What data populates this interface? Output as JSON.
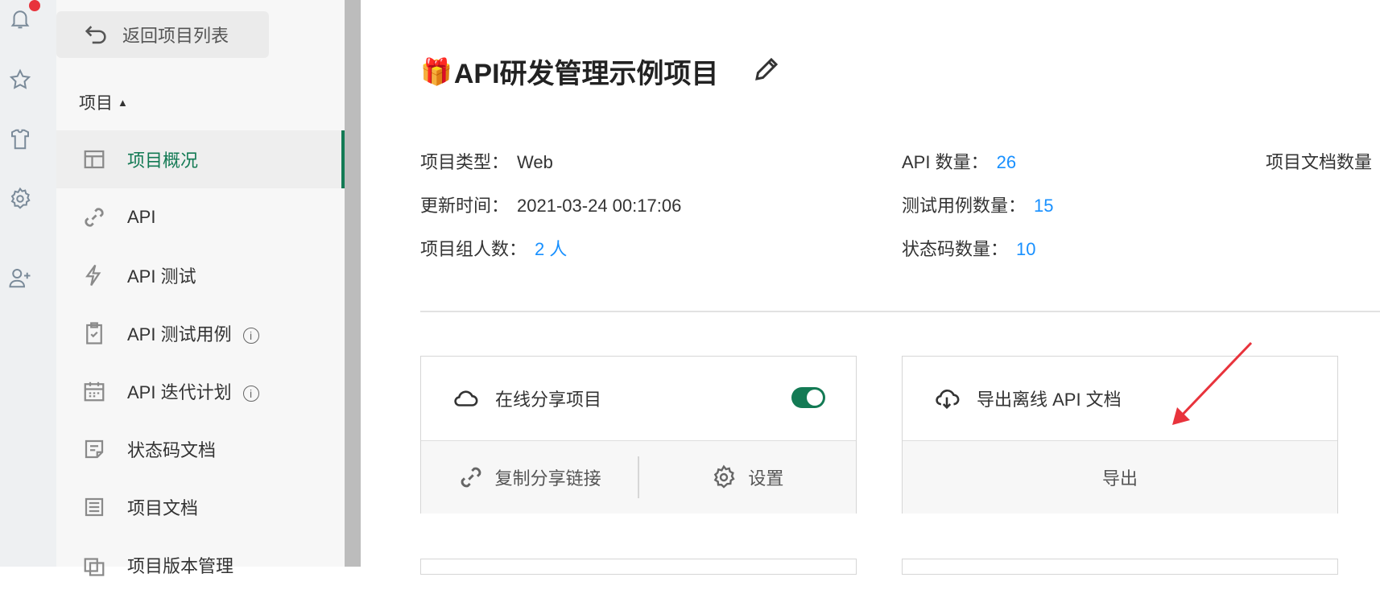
{
  "rail": {
    "icons": [
      "bell-icon",
      "star-icon",
      "shirt-icon",
      "settings-icon",
      "add-user-icon"
    ]
  },
  "sidebar": {
    "back_label": "返回项目列表",
    "section_label": "项目",
    "items": [
      {
        "label": "项目概况",
        "icon": "dashboard-icon"
      },
      {
        "label": "API",
        "icon": "link-icon"
      },
      {
        "label": "API 测试",
        "icon": "lightning-icon"
      },
      {
        "label": "API 测试用例",
        "icon": "clipboard-check-icon",
        "info": "i"
      },
      {
        "label": "API 迭代计划",
        "icon": "calendar-icon",
        "info": "i"
      },
      {
        "label": "状态码文档",
        "icon": "note-icon"
      },
      {
        "label": "项目文档",
        "icon": "list-doc-icon"
      },
      {
        "label": "项目版本管理",
        "icon": "version-icon"
      }
    ]
  },
  "main": {
    "title": "API研发管理示例项目",
    "title_emoji": "🎁",
    "meta": {
      "type_label": "项目类型：",
      "type_value": "Web",
      "updated_label": "更新时间：",
      "updated_value": "2021-03-24 00:17:06",
      "members_label": "项目组人数：",
      "members_value": "2 人",
      "api_count_label": "API 数量：",
      "api_count_value": "26",
      "testcase_label": "测试用例数量：",
      "testcase_value": "15",
      "status_code_label": "状态码数量：",
      "status_code_value": "10",
      "doc_count_label": "项目文档数量"
    },
    "share_card": {
      "title": "在线分享项目",
      "toggle_on": true,
      "copy_link_label": "复制分享链接",
      "settings_label": "设置"
    },
    "export_card": {
      "title": "导出离线 API 文档",
      "export_label": "导出"
    }
  },
  "colors": {
    "accent": "#137a54",
    "link": "#1890ff",
    "annotation_arrow": "#e8333c"
  }
}
